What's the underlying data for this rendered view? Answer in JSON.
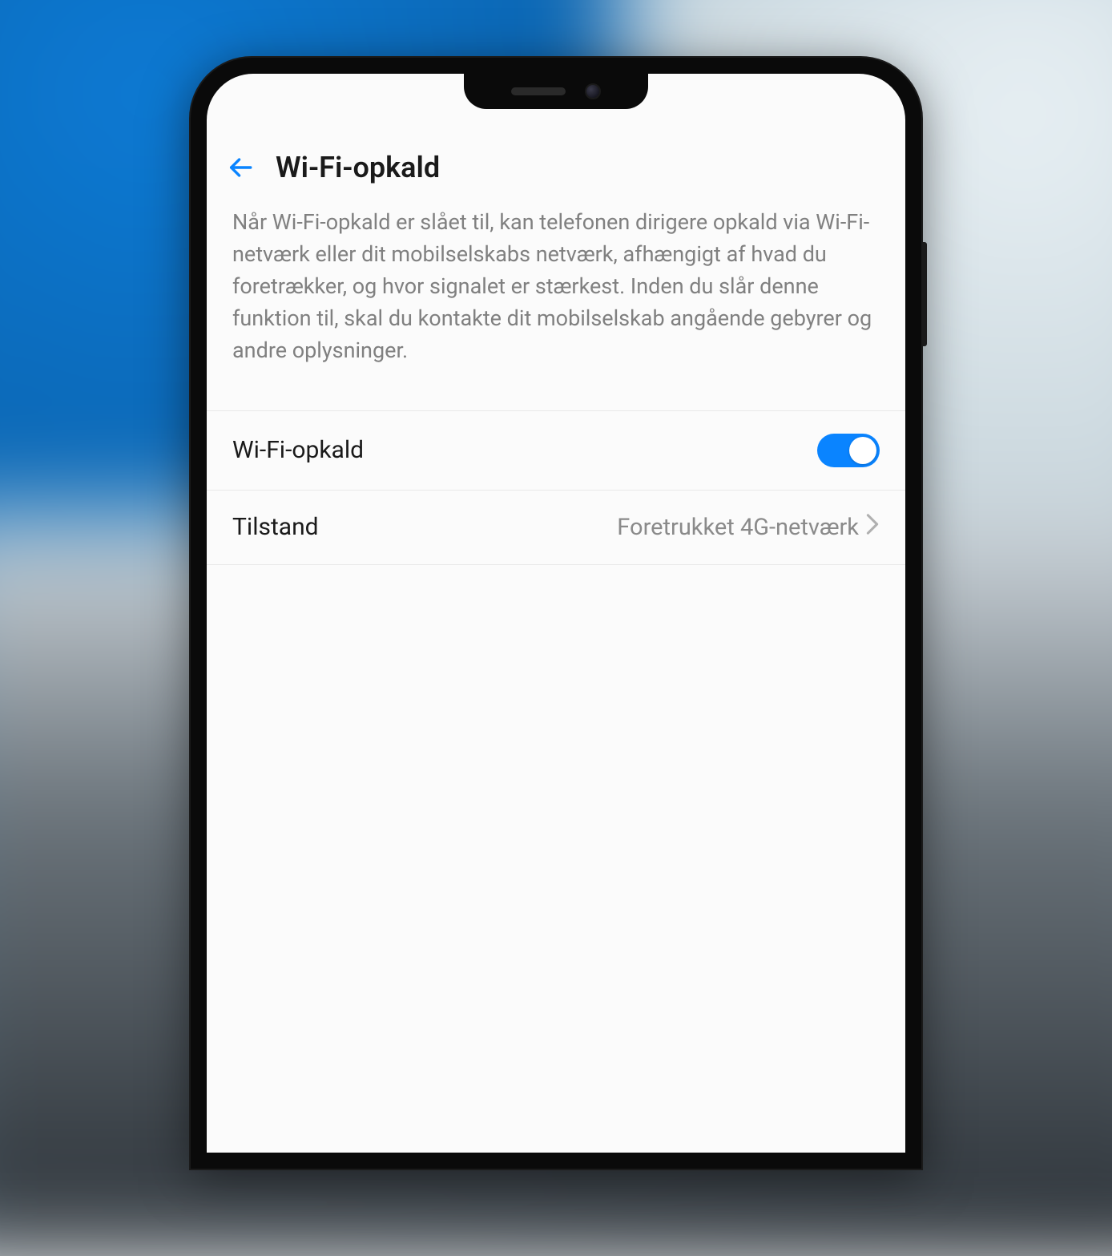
{
  "header": {
    "title": "Wi-Fi-opkald"
  },
  "description": "Når Wi-Fi-opkald er slået til, kan telefonen dirigere opkald via Wi-Fi-netværk eller dit mobilselskabs netværk, afhængigt af hvad du foretrækker, og hvor signalet er stærkest. Inden du slår denne funktion til, skal du kontakte dit mobilselskab angående gebyrer og andre oplysninger.",
  "settings": {
    "wifiCalling": {
      "label": "Wi-Fi-opkald",
      "enabled": true
    },
    "mode": {
      "label": "Tilstand",
      "value": "Foretrukket 4G-netværk"
    }
  },
  "colors": {
    "accent": "#0a84ff",
    "text": "#1a1a1a",
    "muted": "#808080"
  }
}
